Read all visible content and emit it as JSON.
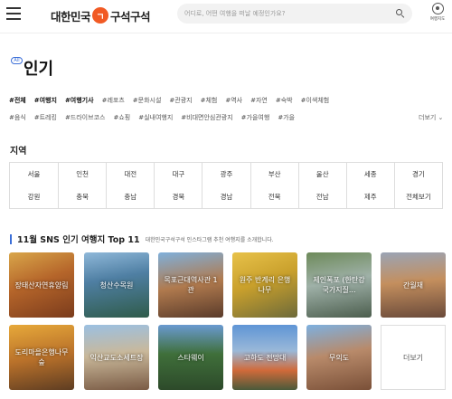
{
  "header": {
    "logo_left": "대한민국",
    "logo_mark": "ㄱ",
    "logo_right": "구석구석",
    "search_placeholder": "어디로, 어떤 여행을 떠날 예정인가요?",
    "mytour_label": "여행지도",
    "icons": [
      "menu-icon",
      "search-icon",
      "user-icon"
    ]
  },
  "title": {
    "badge": "All",
    "text": "인기"
  },
  "tags": {
    "row1": [
      "#전체",
      "#여행지",
      "#여행기사",
      "#레포츠",
      "#문화시설",
      "#관광지",
      "#체험",
      "#역사",
      "#자연",
      "#숙박",
      "#이색체험"
    ],
    "row2": [
      "#음식",
      "#트레킹",
      "#드라이브코스",
      "#쇼핑",
      "#실내여행지",
      "#비대면안심관광지",
      "#가을여행",
      "#가을"
    ],
    "active": [
      "#전체",
      "#여행지",
      "#여행기사"
    ],
    "more": "더보기 ⌄"
  },
  "region": {
    "label": "지역",
    "row1": [
      "서울",
      "인천",
      "대전",
      "대구",
      "광주",
      "부산",
      "울산",
      "세종",
      "경기"
    ],
    "row2": [
      "강원",
      "충북",
      "충남",
      "경북",
      "경남",
      "전북",
      "전남",
      "제주",
      "전체보기"
    ]
  },
  "top": {
    "title": "11월 SNS 인기 여행지 Top 11",
    "subtitle": "대한민국구석구석 인스타그램 추천 여행지를 소개합니다.",
    "cards": [
      {
        "label": "장태산자연휴양림"
      },
      {
        "label": "청산수목원"
      },
      {
        "label": "목포근대역사관 1관"
      },
      {
        "label": "원주 반계리 은행나무"
      },
      {
        "label": "제인폭포 (한탄강 국가지질..."
      },
      {
        "label": "간월재"
      },
      {
        "label": "도리마을은행나무숲"
      },
      {
        "label": "익산교도소세트장"
      },
      {
        "label": "스타웨이"
      },
      {
        "label": "고하도 전망대"
      },
      {
        "label": "무의도"
      }
    ],
    "more": "더보기"
  },
  "colors": {
    "accent": "#3c6fd8",
    "brand": "#f15a24"
  }
}
